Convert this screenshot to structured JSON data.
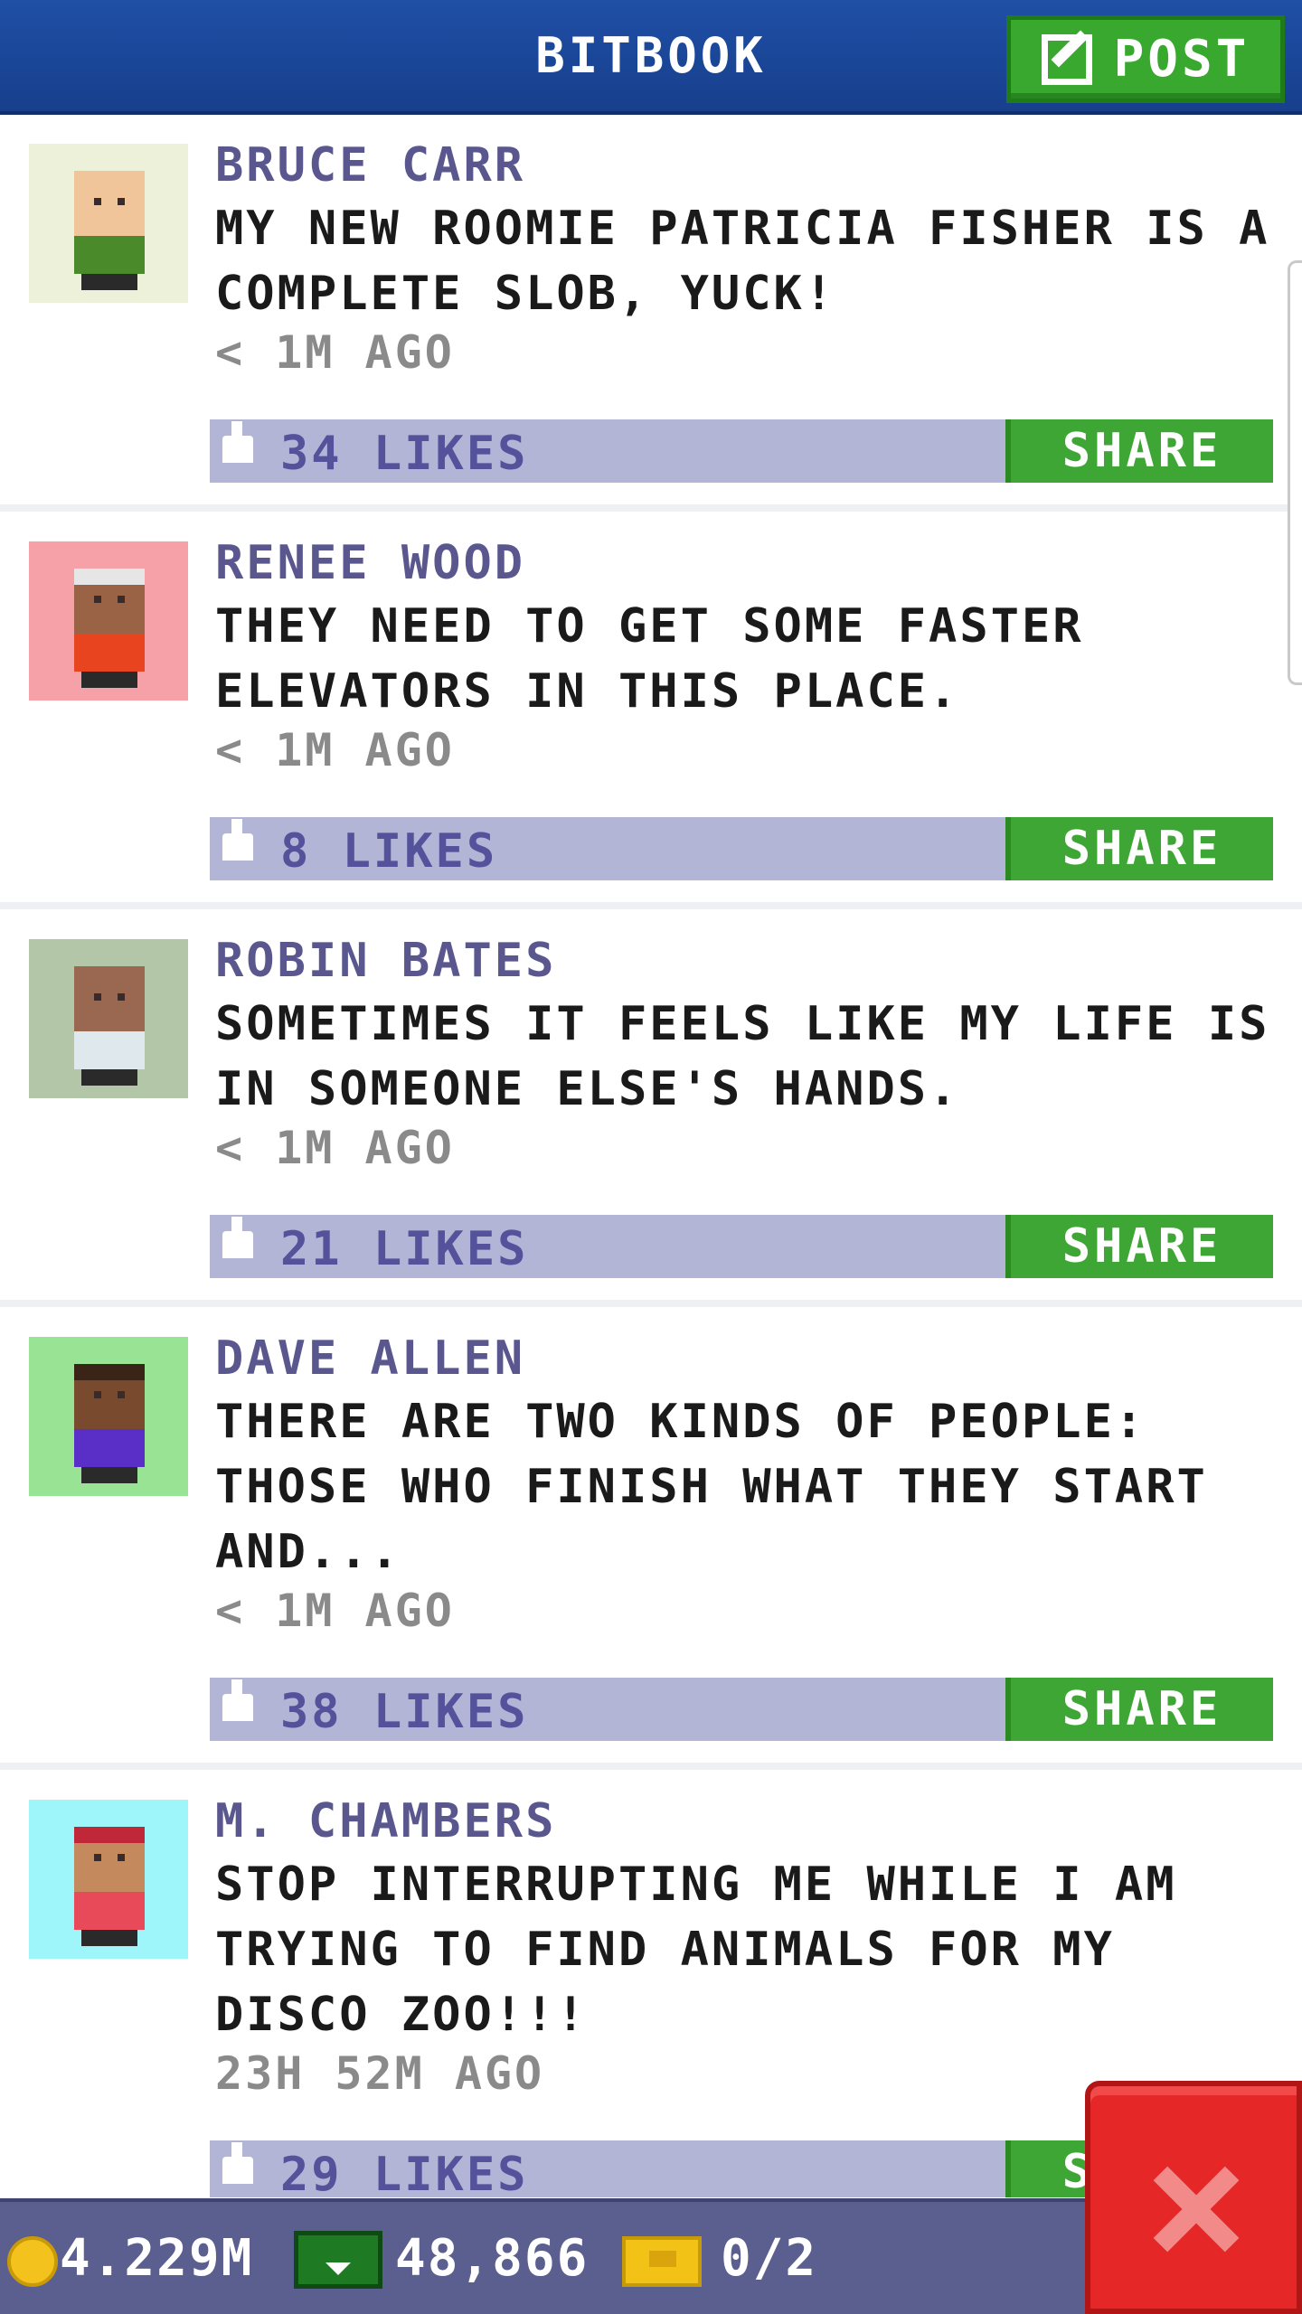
{
  "header": {
    "title": "BITBOOK",
    "post_label": "POST"
  },
  "posts": [
    {
      "author": "BRUCE CARR",
      "message": "MY NEW ROOMIE PATRICIA FISHER IS A COMPLETE SLOB, YUCK!",
      "time": "< 1M AGO",
      "likes": "34 LIKES",
      "share": "SHARE",
      "avatar_bg": "#eef1da",
      "shirt": "#4a8a2a",
      "skin": "#f0c59a",
      "hair": "#f0c59a"
    },
    {
      "author": "RENEE WOOD",
      "message": "THEY NEED TO GET SOME FASTER ELEVATORS IN THIS PLACE.",
      "time": "< 1M AGO",
      "likes": "8 LIKES",
      "share": "SHARE",
      "avatar_bg": "#f6a1a8",
      "shirt": "#e8441f",
      "skin": "#9a6346",
      "hair": "#e6e6e6"
    },
    {
      "author": "ROBIN BATES",
      "message": "SOMETIMES IT FEELS LIKE MY LIFE IS IN SOMEONE ELSE'S HANDS.",
      "time": "< 1M AGO",
      "likes": "21 LIKES",
      "share": "SHARE",
      "avatar_bg": "#b3c6a8",
      "shirt": "#dfe8ec",
      "skin": "#9a6850",
      "hair": "#9a6850"
    },
    {
      "author": "DAVE ALLEN",
      "message": "THERE ARE TWO KINDS OF PEOPLE: THOSE WHO FINISH WHAT THEY START AND...",
      "time": "< 1M AGO",
      "likes": "38 LIKES",
      "share": "SHARE",
      "avatar_bg": "#98e394",
      "shirt": "#5a2fc7",
      "skin": "#7a4a2e",
      "hair": "#3a2418"
    },
    {
      "author": "M. CHAMBERS",
      "message": "STOP INTERRUPTING ME WHILE I AM TRYING TO FIND ANIMALS FOR MY DISCO ZOO!!!",
      "time": "23H 52M AGO",
      "likes": "29 LIKES",
      "share": "SHARE",
      "avatar_bg": "#9ef6fb",
      "shirt": "#e84a5a",
      "skin": "#c48a5e",
      "hair": "#c0283a"
    }
  ],
  "status": {
    "coins": "4.229M",
    "bux": "48,866",
    "tickets": "0/2"
  },
  "colors": {
    "header": "#1f4fa6",
    "share_green": "#3ea634",
    "likes_bar": "#b3b5d6",
    "author": "#5a578f",
    "close_red": "#e52727"
  },
  "icons": {
    "post": "edit-icon",
    "like": "thumbs-up-icon",
    "coin": "coin-icon",
    "bux": "bux-icon",
    "ticket": "ticket-icon",
    "close": "close-icon"
  }
}
